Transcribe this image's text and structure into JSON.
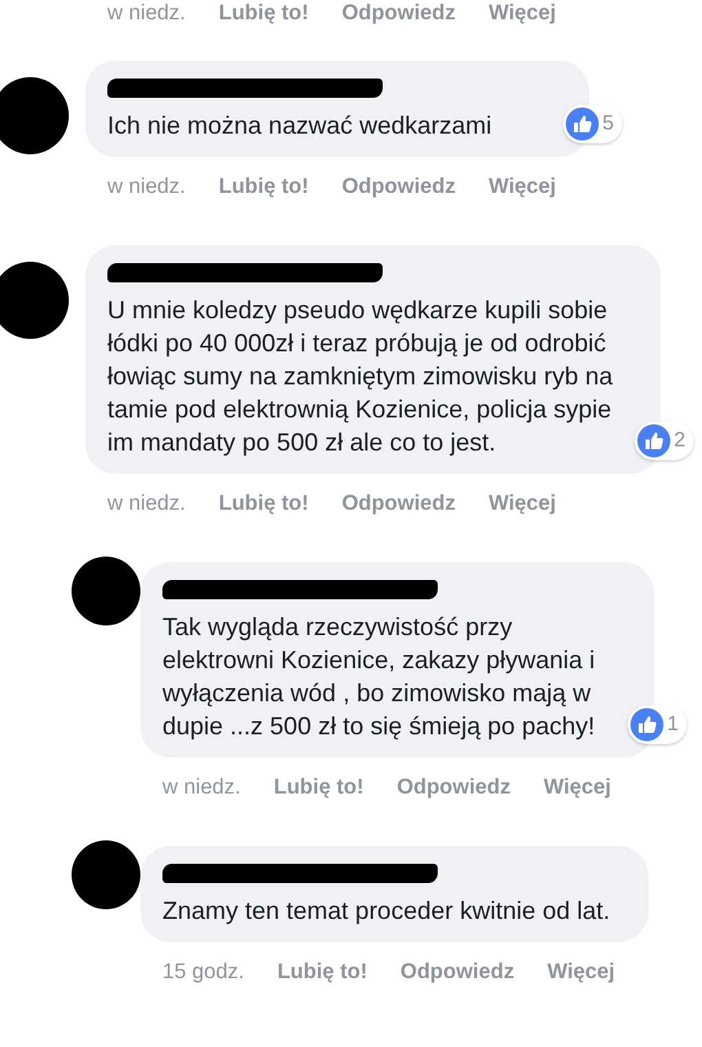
{
  "previous_comment_actions": {
    "time": "w niedz.",
    "like": "Lubię to!",
    "reply": "Odpowiedz",
    "more": "Więcej"
  },
  "comments": [
    {
      "text": "Ich nie można nazwać wedkarzami",
      "reactions": "5",
      "time": "w niedz.",
      "like": "Lubię to!",
      "reply": "Odpowiedz",
      "more": "Więcej"
    },
    {
      "text": "U mnie koledzy pseudo wędkarze kupili sobie łódki po 40 000zł i teraz próbują je od odrobić łowiąc sumy na zamkniętym zimowisku ryb na tamie pod elektrownią Kozienice, policja sypie im mandaty po 500 zł ale co to jest.",
      "reactions": "2",
      "time": "w niedz.",
      "like": "Lubię to!",
      "reply": "Odpowiedz",
      "more": "Więcej",
      "children": [
        {
          "text": "Tak wygląda rzeczywistość przy elektrowni Kozienice, zakazy pływania i wyłączenia wód , bo zimowisko mają w dupie ...z 500 zł to się śmieją po pachy!",
          "reactions": "1",
          "time": "w niedz.",
          "like": "Lubię to!",
          "reply": "Odpowiedz",
          "more": "Więcej"
        },
        {
          "text": "Znamy ten temat proceder kwitnie od lat.",
          "time": "15 godz.",
          "like": "Lubię to!",
          "reply": "Odpowiedz",
          "more": "Więcej"
        }
      ]
    }
  ]
}
